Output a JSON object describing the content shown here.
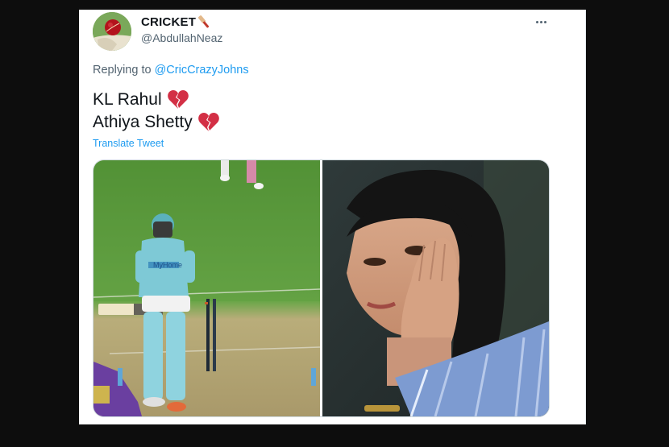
{
  "tweet": {
    "display_name": "CRICKET",
    "handle": "@AbdullahNeaz",
    "replying_prefix": "Replying to",
    "replying_to": "@CricCrazyJohns",
    "lines": [
      "KL Rahul",
      "Athiya Shetty"
    ],
    "line_emoji": "broken-heart-icon",
    "name_emoji": "cricket-bat-icon",
    "translate_label": "Translate Tweet",
    "jersey_text": "MyHome"
  },
  "colors": {
    "link": "#1d9bf0",
    "text_primary": "#0f1419",
    "text_secondary": "#536471",
    "broken_heart": "#d32f45",
    "pitch_green": "#5e9a3c",
    "jersey_blue": "#7ec9d6"
  }
}
